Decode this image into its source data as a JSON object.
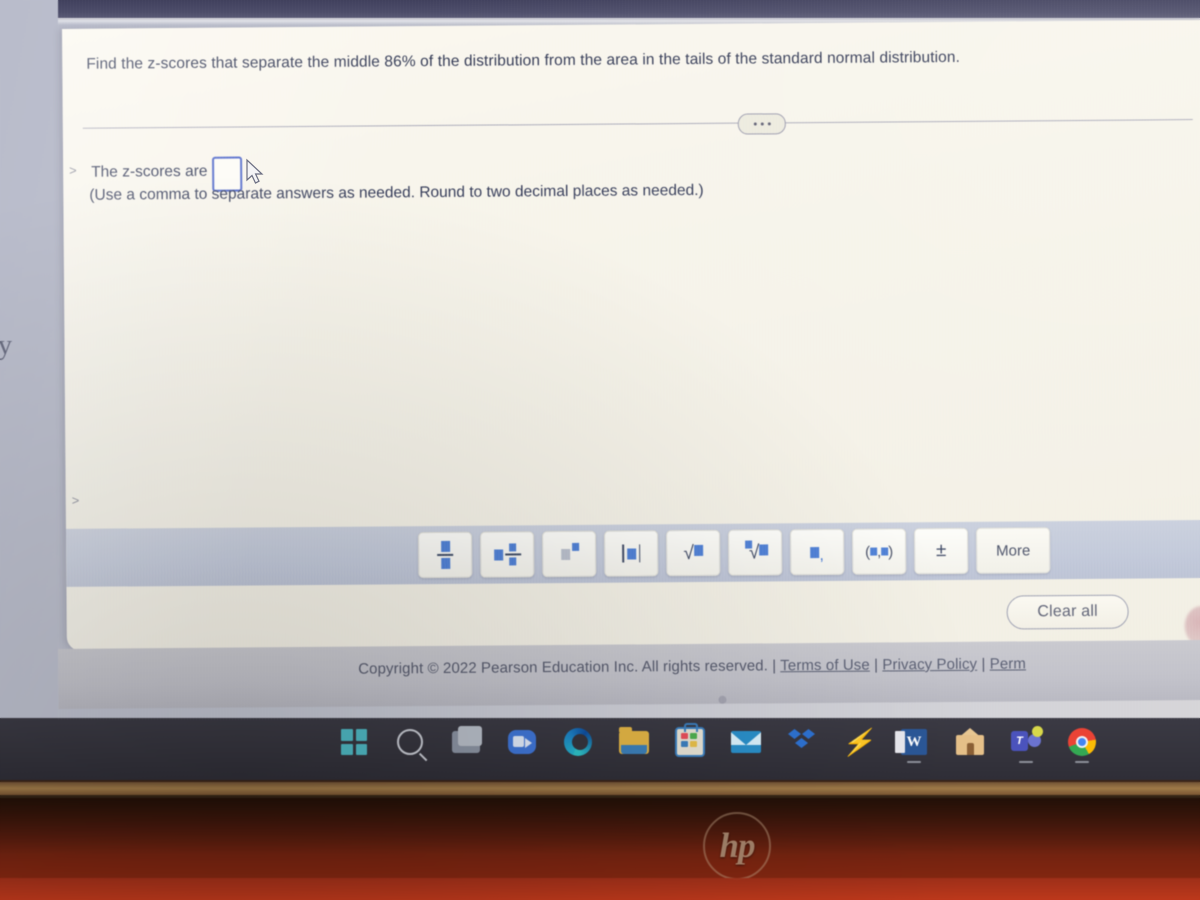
{
  "question": {
    "prompt": "Find the z-scores that separate the middle 86% of the distribution from the area in the tails of the standard normal distribution.",
    "answer_label": "The z-scores are",
    "answer_value": "",
    "instruction": "(Use a comma to separate answers as needed. Round to two decimal places as needed.)",
    "expand_icon": "ellipsis-icon"
  },
  "palette": {
    "buttons": [
      {
        "name": "fraction",
        "label": "▪/▪"
      },
      {
        "name": "mixed-number",
        "label": "▪ ▪/▪"
      },
      {
        "name": "exponent",
        "label": "▪^▪"
      },
      {
        "name": "absolute-value",
        "label": "|▪|"
      },
      {
        "name": "square-root",
        "label": "√▪"
      },
      {
        "name": "nth-root",
        "label": "ⁿ√▪"
      },
      {
        "name": "list-separator",
        "label": "▪,"
      },
      {
        "name": "ordered-pair",
        "label": "(▪,▪)"
      },
      {
        "name": "plus-minus",
        "label": "±"
      }
    ],
    "more_label": "More"
  },
  "actions": {
    "clear_all_label": "Clear all"
  },
  "footer": {
    "copyright": "Copyright © 2022 Pearson Education Inc. All rights reserved.",
    "separator": "|",
    "links": [
      "Terms of Use",
      "Privacy Policy",
      "Perm"
    ]
  },
  "taskbar": {
    "icons": [
      "start-icon",
      "search-icon",
      "task-view-icon",
      "zoom-icon",
      "edge-icon",
      "file-explorer-icon",
      "microsoft-store-icon",
      "mail-icon",
      "dropbox-icon",
      "lightning-icon",
      "word-icon",
      "home-icon",
      "teams-icon",
      "chrome-icon"
    ],
    "word_letter": "W",
    "teams_letter": "T"
  },
  "device": {
    "brand": "hp"
  },
  "stray": {
    "left_edge_letter": "y"
  },
  "colors": {
    "accent_blue": "#4d7fd6",
    "input_border": "#4a63c8",
    "page_bg": "#f8f5ec",
    "palette_bg": "#c5ccdc",
    "top_band": "#4b4b68",
    "taskbar": "#35343d"
  }
}
